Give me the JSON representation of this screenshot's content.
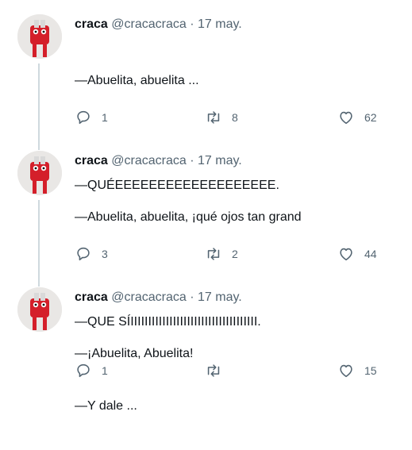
{
  "tweets": [
    {
      "name": "craca",
      "handle": "@cracacraca",
      "date": "17 may.",
      "line1": "—Abuelita, abuelita ...",
      "line2": "",
      "line3": "—QUÉEEEEEEEEEEEEEEEEEEE.",
      "replies": "1",
      "retweets": "8",
      "likes": "62"
    },
    {
      "name": "craca",
      "handle": "@cracacraca",
      "date": "17 may.",
      "line1": "—Abuelita, abuelita, ¡qué ojos tan grand",
      "line2": "",
      "line3": "—QUE SÍIIIIIIIIIIIIIIIIIIIIIIIIIIIIIIIIIIII.",
      "replies": "3",
      "retweets": "2",
      "likes": "44"
    },
    {
      "name": "craca",
      "handle": "@cracacraca",
      "date": "17 may.",
      "line1": "—¡Abuelita, Abuelita!",
      "line2": "—Y dale ...",
      "line3": "",
      "replies": "1",
      "retweets": "",
      "likes": "15"
    }
  ],
  "separator": "·",
  "icons": {
    "reply": "reply-icon",
    "retweet": "retweet-icon",
    "like": "heart-icon"
  },
  "colors": {
    "text": "#0f1419",
    "muted": "#536471",
    "thread_line": "#cfd9de",
    "avatar_red": "#d41f2a"
  }
}
